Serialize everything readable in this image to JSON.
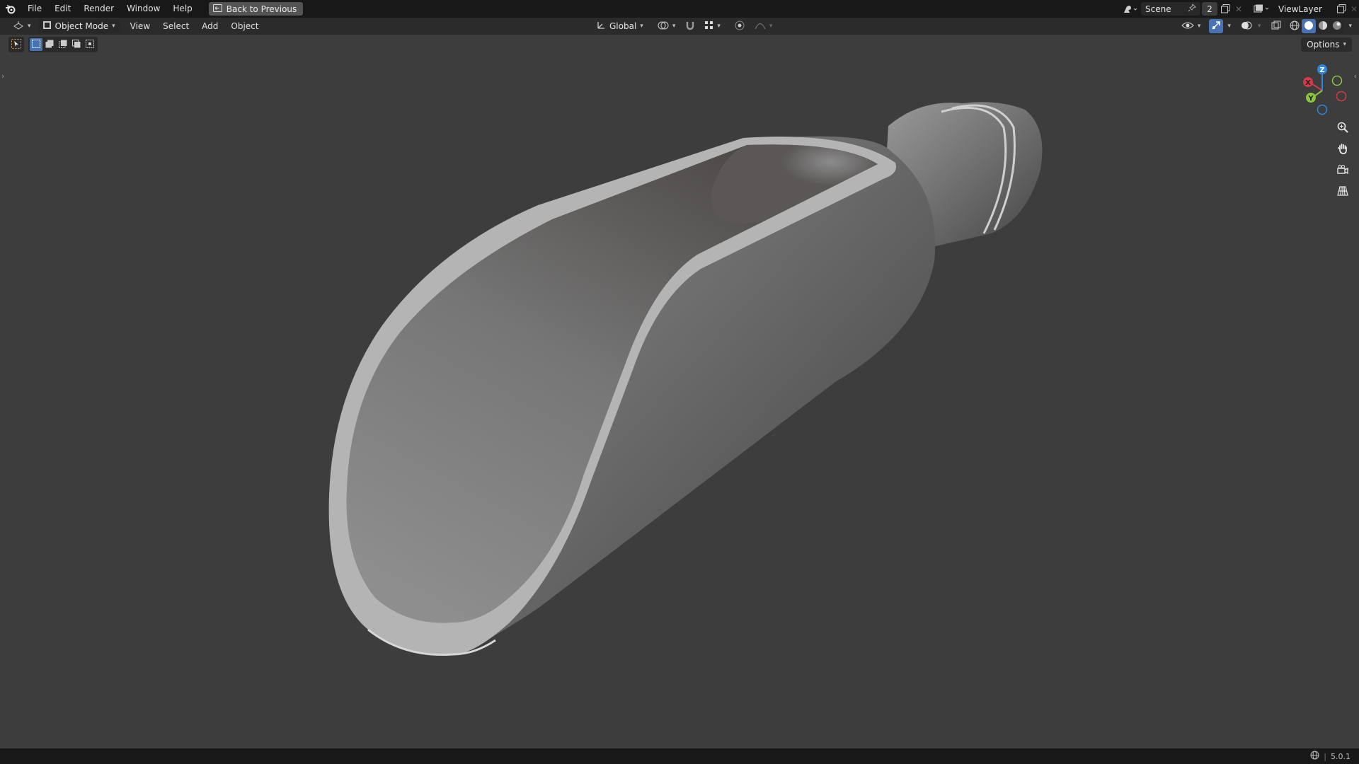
{
  "topbar": {
    "menus": [
      "File",
      "Edit",
      "Render",
      "Window",
      "Help"
    ],
    "back_button": "Back to Previous",
    "scene_name": "Scene",
    "scene_users": "2",
    "view_layer": "ViewLayer"
  },
  "header": {
    "mode": "Object Mode",
    "menus": [
      "View",
      "Select",
      "Add",
      "Object"
    ],
    "transform_orientation": "Global"
  },
  "options_label": "Options",
  "gizmo": {
    "x": "X",
    "y": "Y",
    "z": "Z"
  },
  "status": {
    "version": "5.0.1"
  },
  "colors": {
    "accent": "#4772b3",
    "axis_x": "#d63a48",
    "axis_y": "#8bc53b",
    "axis_z": "#2f86dd",
    "viewport_bg": "#3d3d3d"
  }
}
